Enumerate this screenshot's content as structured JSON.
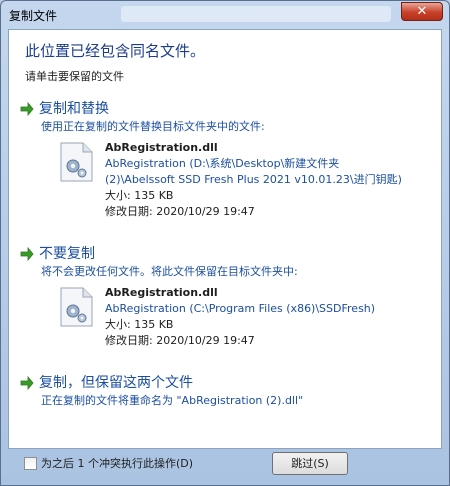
{
  "window": {
    "title": "复制文件",
    "close_label": "✕"
  },
  "dialog": {
    "heading": "此位置已经包含同名文件。",
    "subheading": "请单击要保留的文件"
  },
  "options": [
    {
      "title": "复制和替换",
      "description": "使用正在复制的文件替换目标文件夹中的文件:",
      "file": {
        "name": "AbRegistration.dll",
        "path_line1": "AbRegistration (D:\\系统\\Desktop\\新建文件夹",
        "path_line2": "(2)\\Abelssoft SSD Fresh Plus 2021 v10.01.23\\进门钥匙)",
        "size": "大小: 135 KB",
        "modified": "修改日期: 2020/10/29 19:47"
      }
    },
    {
      "title": "不要复制",
      "description": "将不会更改任何文件。将此文件保留在目标文件夹中:",
      "file": {
        "name": "AbRegistration.dll",
        "path_line1": "AbRegistration (C:\\Program Files (x86)\\SSDFresh)",
        "size": "大小: 135 KB",
        "modified": "修改日期: 2020/10/29 19:47"
      }
    },
    {
      "title": "复制，但保留这两个文件",
      "description": "正在复制的文件将重命名为 \"AbRegistration (2).dll\""
    }
  ],
  "footer": {
    "checkbox_label": "为之后 1 个冲突执行此操作(D)",
    "skip_label": "跳过(S)"
  },
  "colors": {
    "link_blue": "#1c4fa0",
    "heading_blue": "#1d3c8c",
    "arrow_green": "#3a9a2a"
  }
}
